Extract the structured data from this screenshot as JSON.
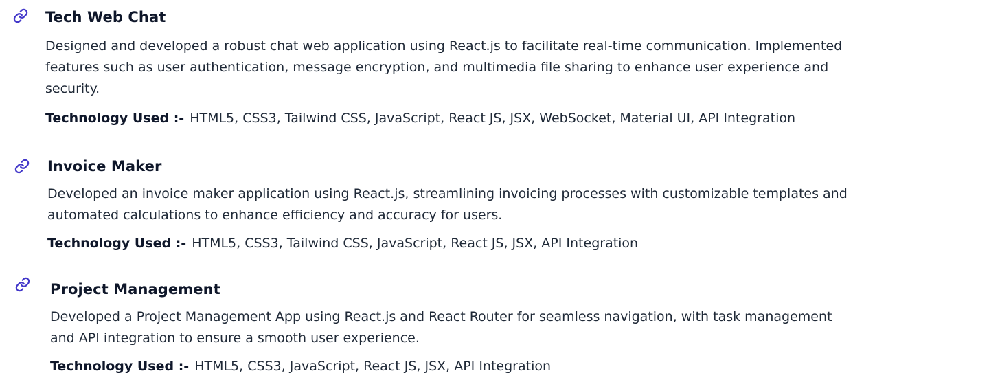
{
  "projects": [
    {
      "title": "Tech Web Chat",
      "description_lines": [
        "Designed and developed a robust chat web application using React.js to facilitate real-time communication. Implemented",
        "features such as user authentication, message encryption, and multimedia file sharing to enhance user experience and",
        "security."
      ],
      "tech_label": "Technology Used :-",
      "tech_list": "HTML5, CSS3, Tailwind CSS, JavaScript, React JS, JSX, WebSocket, Material UI, API Integration",
      "icon": "link-icon"
    },
    {
      "title": "Invoice Maker",
      "description_lines": [
        "Developed an invoice maker application using React.js, streamlining invoicing processes with customizable templates and",
        "automated calculations to enhance efficiency and accuracy for users."
      ],
      "tech_label": "Technology Used :-",
      "tech_list": "HTML5, CSS3, Tailwind CSS, JavaScript, React JS, JSX, API Integration",
      "icon": "link-icon"
    },
    {
      "title": "Project Management",
      "description_lines": [
        "Developed a Project Management App using React.js and React Router for seamless navigation, with task management",
        "and API integration to ensure a smooth user experience."
      ],
      "tech_label": "Technology Used :-",
      "tech_list": "HTML5, CSS3, JavaScript, React JS, JSX, API Integration",
      "icon": "link-icon"
    }
  ],
  "colors": {
    "accent": "#4338ca",
    "heading": "#0f172a",
    "text": "#1f2937"
  }
}
